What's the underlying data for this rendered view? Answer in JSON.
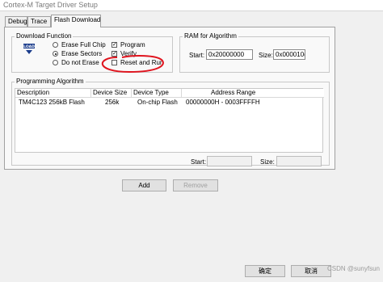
{
  "window": {
    "title": "Cortex-M Target Driver Setup"
  },
  "tabs": [
    {
      "label": "Debug"
    },
    {
      "label": "Trace"
    },
    {
      "label": "Flash Download"
    }
  ],
  "download_function": {
    "legend": "Download Function",
    "icon": "load-icon",
    "erase_options": [
      {
        "label": "Erase Full Chip",
        "selected": false
      },
      {
        "label": "Erase Sectors",
        "selected": true
      },
      {
        "label": "Do not Erase",
        "selected": false
      }
    ],
    "checks": [
      {
        "label": "Program",
        "checked": true
      },
      {
        "label": "Verify",
        "checked": true
      },
      {
        "label": "Reset and Run",
        "checked": false
      }
    ]
  },
  "ram": {
    "legend": "RAM for Algorithm",
    "start_label": "Start:",
    "start_value": "0x20000000",
    "size_label": "Size:",
    "size_value": "0x000010("
  },
  "programming_algorithm": {
    "legend": "Programming Algorithm",
    "columns": [
      "Description",
      "Device Size",
      "Device Type",
      "Address Range"
    ],
    "rows": [
      {
        "description": "TM4C123 256kB Flash",
        "device_size": "256k",
        "device_type": "On-chip Flash",
        "address_range": "00000000H - 0003FFFFH"
      }
    ],
    "start_label": "Start:",
    "size_label": "Size:"
  },
  "buttons": {
    "add": "Add",
    "remove": "Remove",
    "ok": "确定",
    "cancel": "取消"
  },
  "watermark": "CSDN @sunyfsun",
  "annotation_color": "#e0141e"
}
